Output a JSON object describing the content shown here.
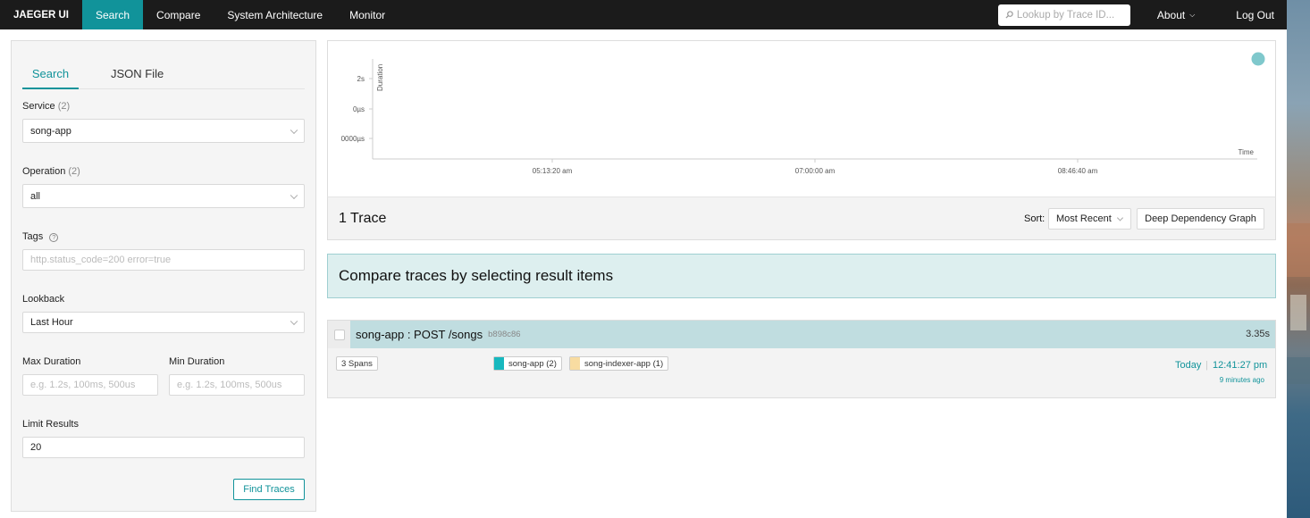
{
  "nav": {
    "brand": "JAEGER UI",
    "items": [
      {
        "label": "Search"
      },
      {
        "label": "Compare"
      },
      {
        "label": "System Architecture"
      },
      {
        "label": "Monitor"
      }
    ],
    "lookup_placeholder": "Lookup by Trace ID...",
    "about": "About",
    "logout": "Log Out"
  },
  "search_form": {
    "tabs": [
      {
        "label": "Search"
      },
      {
        "label": "JSON File"
      }
    ],
    "service": {
      "label": "Service",
      "count": "(2)",
      "value": "song-app"
    },
    "operation": {
      "label": "Operation",
      "count": "(2)",
      "value": "all"
    },
    "tags": {
      "label": "Tags",
      "placeholder": "http.status_code=200 error=true"
    },
    "lookback": {
      "label": "Lookback",
      "value": "Last Hour"
    },
    "max_duration": {
      "label": "Max Duration",
      "placeholder": "e.g. 1.2s, 100ms, 500us"
    },
    "min_duration": {
      "label": "Min Duration",
      "placeholder": "e.g. 1.2s, 100ms, 500us"
    },
    "limit": {
      "label": "Limit Results",
      "value": "20"
    },
    "find_button": "Find Traces"
  },
  "chart_data": {
    "type": "scatter",
    "title": "",
    "xlabel": "Time",
    "ylabel": "Duration",
    "y_tick_labels": [
      "2s",
      "0µs",
      "0000µs"
    ],
    "x_tick_labels": [
      "05:13:20 am",
      "07:00:00 am",
      "08:46:40 am"
    ],
    "points": [
      {
        "x": "12:41:27 pm",
        "y": 3.35
      }
    ],
    "point_color": "#7fc8cc",
    "grid": false
  },
  "results": {
    "count_label": "1 Trace",
    "sort_label": "Sort:",
    "sort_value": "Most Recent",
    "ddg_button": "Deep Dependency Graph"
  },
  "compare_banner": "Compare traces by selecting result items",
  "trace": {
    "title": "song-app : POST /songs",
    "id": "b898c86",
    "duration": "3.35s",
    "spans": "3 Spans",
    "services": [
      {
        "label": "song-app (2)",
        "color": "#17b8be"
      },
      {
        "label": "song-indexer-app (1)",
        "color": "#f8dca1"
      }
    ],
    "date": "Today",
    "time": "12:41:27 pm",
    "ago": "9 minutes ago"
  }
}
